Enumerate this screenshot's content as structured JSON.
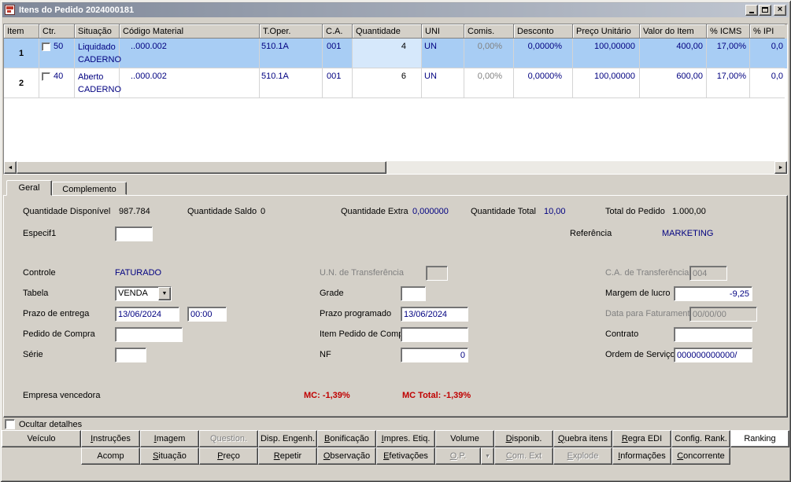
{
  "colors": {
    "value_navy": "#000080",
    "alert_red": "#c00000",
    "row_selection_blue": "#a8cdf4",
    "titlebar_gradient_start": "#7e8798",
    "titlebar_gradient_end": "#c1c7d1",
    "chrome_gray": "#d4d0c8"
  },
  "window": {
    "title": "Itens do Pedido 2024000181"
  },
  "grid": {
    "columns": [
      "Item",
      "Ctr.",
      "Situação",
      "Código Material",
      "T.Oper.",
      "C.A.",
      "Quantidade",
      "UNI",
      "Comis.",
      "Desconto",
      "Preço Unitário",
      "Valor do Item",
      "% ICMS",
      "% IPI"
    ],
    "rows": [
      {
        "item": "1",
        "ctr": "50",
        "situacao": "Liquidado",
        "material": "CADERNO",
        "codigo": "..000.002",
        "toper": "510.1A",
        "ca": "001",
        "quantidade": "4",
        "uni": "UN",
        "comis": "0,00%",
        "desconto": "0,0000%",
        "preco_unitario": "100,00000",
        "valor_item": "400,00",
        "icms": "17,00%",
        "ipi": "0,0",
        "selected": true
      },
      {
        "item": "2",
        "ctr": "40",
        "situacao": "Aberto",
        "material": "CADERNO",
        "codigo": "..000.002",
        "toper": "510.1A",
        "ca": "001",
        "quantidade": "6",
        "uni": "UN",
        "comis": "0,00%",
        "desconto": "0,0000%",
        "preco_unitario": "100,00000",
        "valor_item": "600,00",
        "icms": "17,00%",
        "ipi": "0,0",
        "selected": false
      }
    ]
  },
  "tabs": {
    "geral": "Geral",
    "complemento": "Complemento"
  },
  "fields": {
    "quantidade_disponivel": {
      "label": "Quantidade Disponível",
      "value": "987.784"
    },
    "quantidade_saldo": {
      "label": "Quantidade Saldo",
      "value": "0"
    },
    "quantidade_extra": {
      "label": "Quantidade Extra",
      "value": "0,000000"
    },
    "quantidade_total": {
      "label": "Quantidade Total",
      "value": "10,00"
    },
    "total_do_pedido": {
      "label": "Total do Pedido",
      "value": "1.000,00"
    },
    "especif1": {
      "label": "Especif1",
      "value": ""
    },
    "referencia": {
      "label": "Referência",
      "value": "MARKETING"
    },
    "controle": {
      "label": "Controle",
      "value": "FATURADO"
    },
    "un_transferencia": {
      "label": "U.N. de Transferência",
      "value": ""
    },
    "ca_transferencia": {
      "label": "C.A. de Transferência",
      "value": "004"
    },
    "tabela": {
      "label": "Tabela",
      "value": "VENDA"
    },
    "grade": {
      "label": "Grade",
      "value": ""
    },
    "margem_lucro": {
      "label": "Margem de lucro",
      "value": "-9,25"
    },
    "prazo_entrega": {
      "label": "Prazo de entrega",
      "date": "13/06/2024",
      "time": "00:00"
    },
    "prazo_programado": {
      "label": "Prazo programado",
      "value": "13/06/2024"
    },
    "data_faturamento": {
      "label": "Data para Faturamento",
      "value": "00/00/00"
    },
    "pedido_compra": {
      "label": "Pedido de Compra",
      "value": ""
    },
    "item_pedido_compra": {
      "label": "Item Pedido de Compra",
      "value": ""
    },
    "contrato": {
      "label": "Contrato",
      "value": ""
    },
    "serie": {
      "label": "Série",
      "value": ""
    },
    "nf": {
      "label": "NF",
      "value": "0"
    },
    "ordem_servico": {
      "label": "Ordem de Serviço",
      "value": "000000000000/"
    },
    "empresa_vencedora": {
      "label": "Empresa vencedora"
    },
    "mc": "MC: -1,39%",
    "mc_total": "MC Total: -1,39%"
  },
  "ocultar_detalhes": {
    "label": "Ocultar detalhes",
    "checked": false
  },
  "buttons_row1": [
    {
      "label": "Veículo",
      "u": -1
    },
    {
      "label": "Instruções",
      "u": 0
    },
    {
      "label": "Imagem",
      "u": 0
    },
    {
      "label": "Question.",
      "u": -1,
      "disabled": true
    },
    {
      "label": "Disp. Engenh.",
      "u": -1
    },
    {
      "label": "Bonificação",
      "u": 0
    },
    {
      "label": "Impres. Etiq.",
      "u": 0
    },
    {
      "label": "Volume",
      "u": -1
    },
    {
      "label": "Disponib.",
      "u": 0
    },
    {
      "label": "Quebra itens",
      "u": 0
    },
    {
      "label": "Regra EDI",
      "u": 0
    },
    {
      "label": "Config. Rank.",
      "u": -1
    },
    {
      "label": "Ranking",
      "u": -1,
      "active": true
    }
  ],
  "buttons_row2": [
    {
      "label": "Acomp",
      "u": -1
    },
    {
      "label": "Situação",
      "u": 0
    },
    {
      "label": "Preço",
      "u": 0
    },
    {
      "label": "Repetir",
      "u": 0
    },
    {
      "label": "Observação",
      "u": 0
    },
    {
      "label": "Efetivações",
      "u": 0
    },
    {
      "label": "O.P.",
      "u": 0,
      "disabled": true,
      "dropdown": true
    },
    {
      "label": "Com. Ext",
      "u": 0,
      "disabled": true
    },
    {
      "label": "Explode",
      "u": 0,
      "disabled": true
    },
    {
      "label": "Informações",
      "u": 0
    },
    {
      "label": "Concorrente",
      "u": 0
    }
  ]
}
